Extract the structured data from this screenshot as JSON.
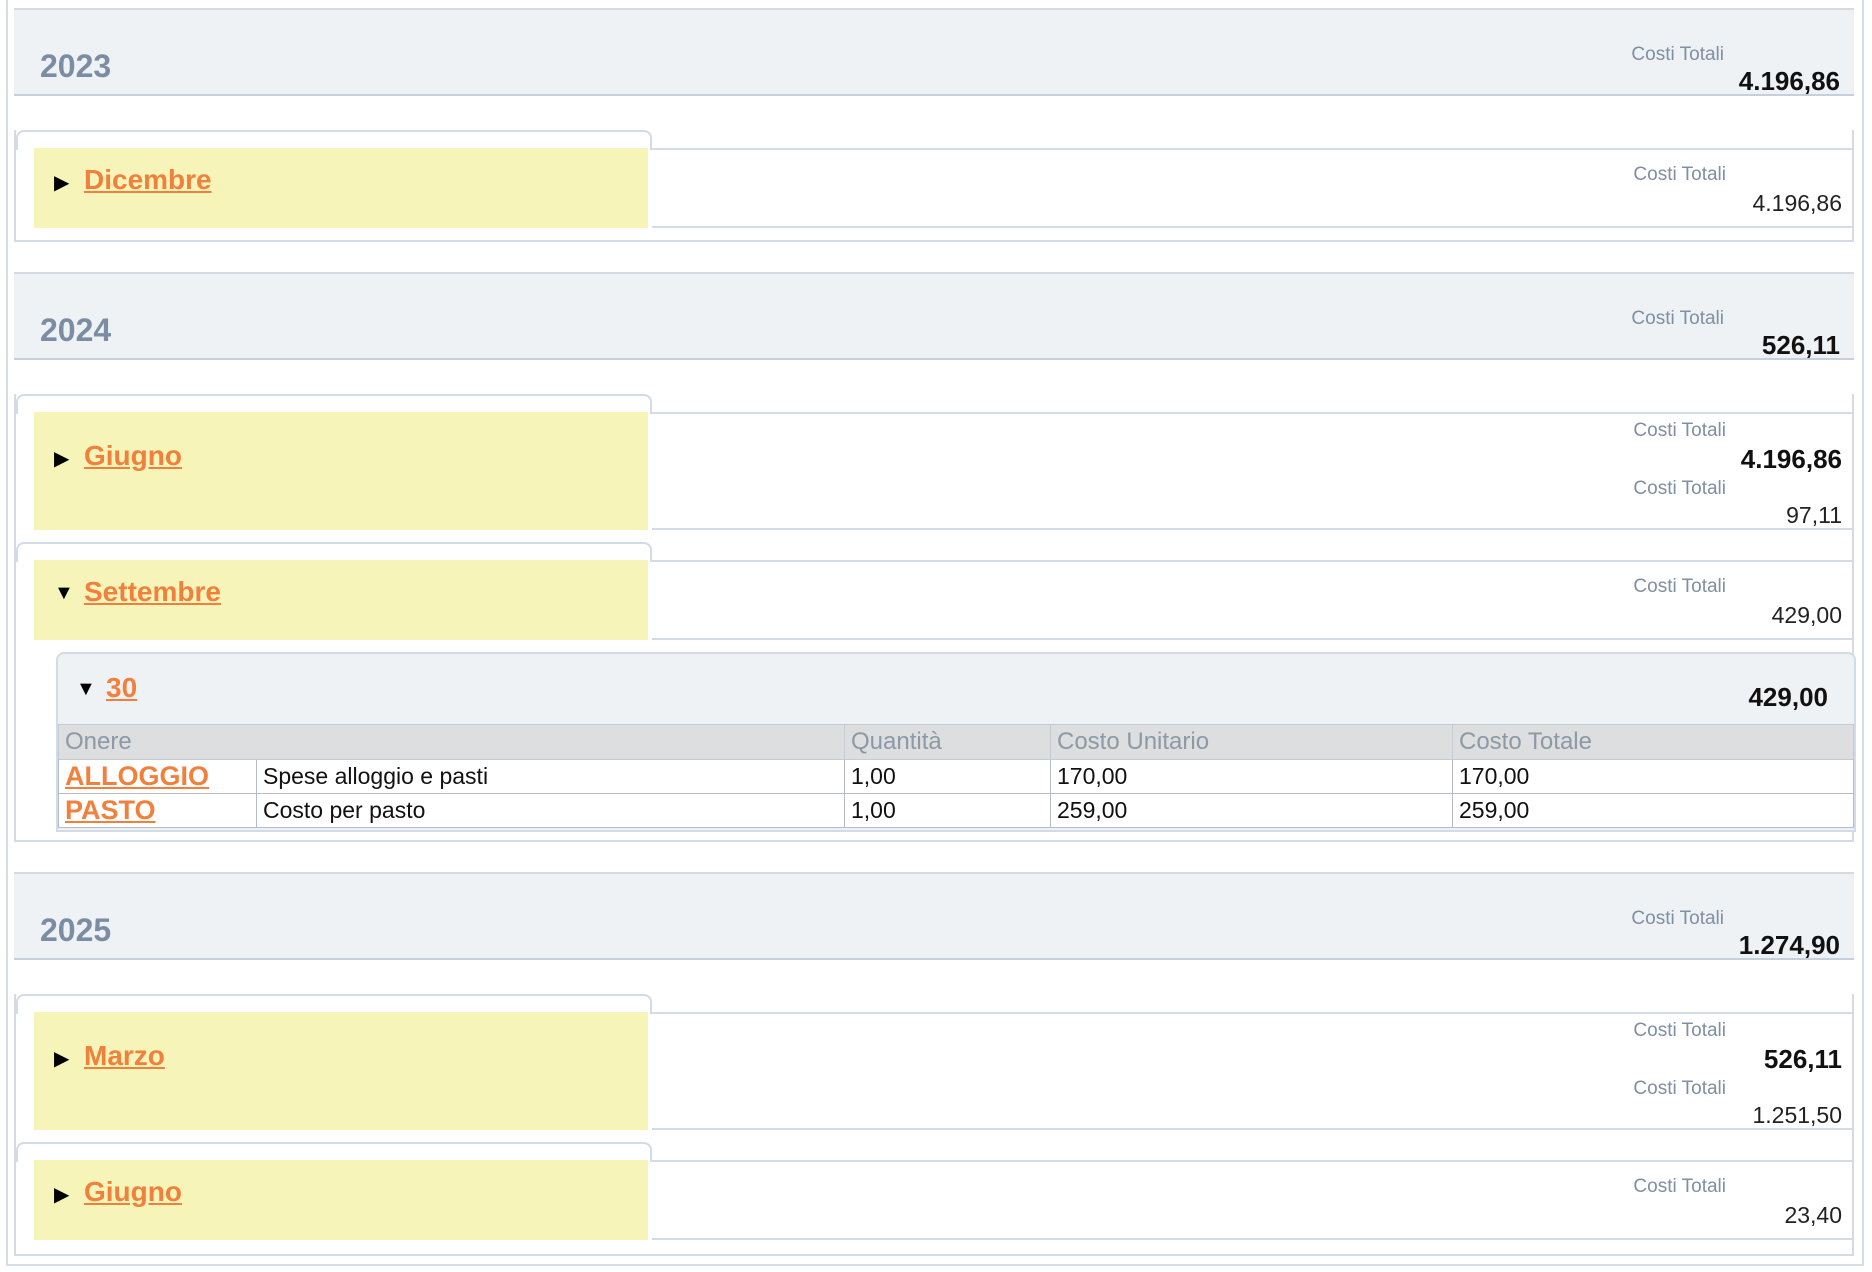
{
  "cost_label": "Costi Totali",
  "years": [
    {
      "year": "2023",
      "total": "4.196,86",
      "months": [
        {
          "name": "Dicembre",
          "costs": [
            "4.196,86"
          ]
        }
      ]
    },
    {
      "year": "2024",
      "total": "526,11",
      "months": [
        {
          "name": "Giugno",
          "costs": [
            "4.196,86",
            "97,11"
          ]
        },
        {
          "name": "Settembre",
          "costs": [
            "429,00"
          ]
        }
      ]
    },
    {
      "year": "2025",
      "total": "1.274,90",
      "months": [
        {
          "name": "Marzo",
          "costs": [
            "526,11",
            "1.251,50"
          ]
        },
        {
          "name": "Giugno",
          "costs": [
            "23,40"
          ]
        }
      ]
    }
  ],
  "day": {
    "label": "30",
    "total": "429,00",
    "columns": [
      "Onere",
      "Quantità",
      "Costo Unitario",
      "Costo Totale"
    ],
    "rows": [
      {
        "code": "ALLOGGIO",
        "description": "Spese alloggio e pasti",
        "qty": "1,00",
        "unit": "170,00",
        "total": "170,00"
      },
      {
        "code": "PASTO",
        "description": "Costo per pasto",
        "qty": "1,00",
        "unit": "259,00",
        "total": "259,00"
      }
    ]
  },
  "icons": {
    "collapsed": "triangle-right-icon",
    "expanded": "triangle-down-icon"
  }
}
